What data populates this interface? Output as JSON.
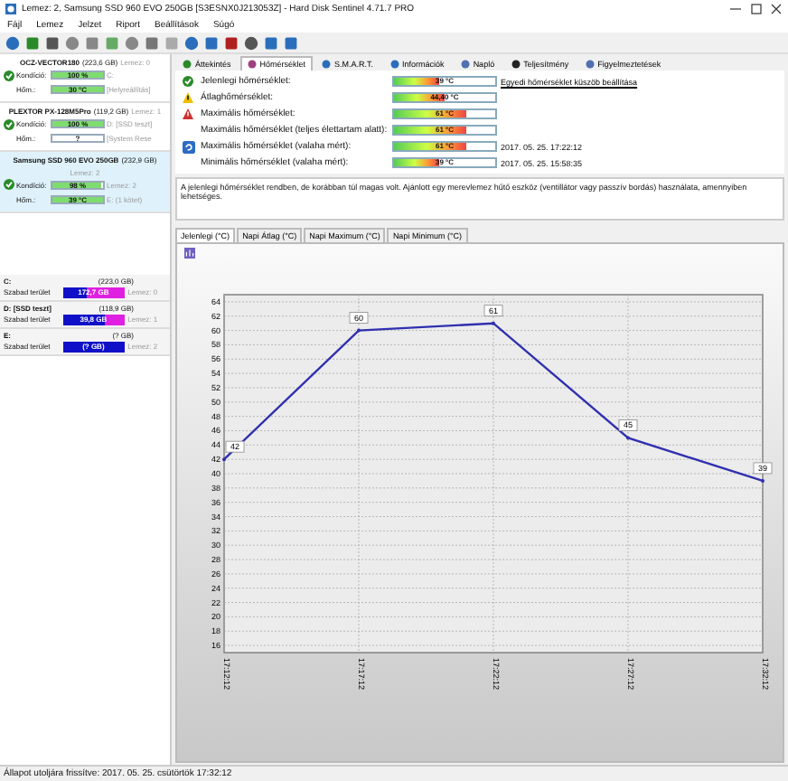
{
  "window": {
    "title": "Lemez: 2, Samsung SSD 960 EVO 250GB [S3ESNX0J213053Z]  -  Hard Disk Sentinel 4.71.7 PRO"
  },
  "menu": [
    "Fájl",
    "Lemez",
    "Jelzet",
    "Riport",
    "Beállítások",
    "Súgó"
  ],
  "disks": [
    {
      "name": "OCZ-VECTOR180",
      "size": "(223,6 GB)",
      "disk_no": "Lemez: 0",
      "selected": false,
      "condition_label": "Kondíció:",
      "condition": {
        "text": "100 %",
        "level": 1
      },
      "condition_extra": "C:",
      "temp_label": "Hőm.:",
      "temp": {
        "text": "30 °C",
        "level": 1
      },
      "temp_extra": "[Helyreállítás]"
    },
    {
      "name": "PLEXTOR PX-128M5Pro",
      "size": "(119,2 GB)",
      "disk_no": "Lemez: 1",
      "selected": false,
      "condition_label": "Kondíció:",
      "condition": {
        "text": "100 %",
        "level": 1
      },
      "condition_extra": "D: [SSD teszt]",
      "temp_label": "Hőm.:",
      "temp": {
        "text": "?",
        "level": 0
      },
      "temp_extra": "[System Rese"
    },
    {
      "name": "Samsung SSD 960 EVO 250GB",
      "size": "(232,9 GB)",
      "disk_no": "Lemez: 2",
      "selected": true,
      "condition_label": "Kondíció:",
      "condition": {
        "text": "98 %",
        "level": 0.98
      },
      "condition_extra": "Lemez: 2",
      "temp_label": "Hőm.:",
      "temp": {
        "text": "39 °C",
        "level": 1
      },
      "temp_extra": "E: (1 kötet)"
    }
  ],
  "partitions": [
    {
      "name": "C:",
      "size": "(223,0 GB)",
      "label": "Szabad terület",
      "free": "172,7 GB",
      "level": 0.6,
      "disk_no": "Lemez: 0"
    },
    {
      "name": "D: [SSD teszt]",
      "size": "(118,9 GB)",
      "label": "Szabad terület",
      "free": "39,8 GB",
      "level": 0.3,
      "disk_no": "Lemez: 1"
    },
    {
      "name": "E:",
      "size": "(? GB)",
      "label": "Szabad terület",
      "free": "(? GB)",
      "level": 0,
      "disk_no": "Lemez: 2"
    }
  ],
  "tabs": [
    {
      "label": "Áttekintés",
      "selected": false
    },
    {
      "label": "Hőmérséklet",
      "selected": true
    },
    {
      "label": "S.M.A.R.T.",
      "selected": false
    },
    {
      "label": "Információk",
      "selected": false
    },
    {
      "label": "Napló",
      "selected": false
    },
    {
      "label": "Teljesítmény",
      "selected": false
    },
    {
      "label": "Figyelmeztetések",
      "selected": false
    }
  ],
  "temperatures": [
    {
      "kind": "ok",
      "label": "Jelenlegi hőmérséklet:",
      "value": "39 °C",
      "level": 0.45,
      "note": "Egyedi hőmérséklet küszöb beállítása"
    },
    {
      "kind": "warning",
      "label": "Átlaghőmérséklet:",
      "value": "44,40 °C",
      "level": 0.5
    },
    {
      "kind": "alert",
      "label": "Maximális hőmérséklet:",
      "value": "61 °C",
      "level": 0.72
    },
    {
      "kind": "none",
      "label": "Maximális hőmérséklet (teljes élettartam alatt):",
      "value": "61 °C",
      "level": 0.72
    },
    {
      "kind": "reset",
      "label": "Maximális hőmérséklet (valaha mért):",
      "value": "61 °C",
      "level": 0.72,
      "date": "2017. 05. 25. 17:22:12"
    },
    {
      "kind": "none",
      "label": "Minimális hőmérséklet (valaha mért):",
      "value": "39 °C",
      "level": 0.45,
      "date": "2017. 05. 25. 15:58:35"
    }
  ],
  "message": "A jelenlegi hőmérséklet rendben, de korábban túl magas volt. Ajánlott egy merevlemez hűtő eszköz (ventillátor vagy passzív bordás) használata, amennyiben lehetséges.",
  "chart_tabs": [
    {
      "label": "Jelenlegi (°C)",
      "selected": true
    },
    {
      "label": "Napi Átlag (°C)",
      "selected": false
    },
    {
      "label": "Napi Maximum (°C)",
      "selected": false
    },
    {
      "label": "Napi Minimum (°C)",
      "selected": false
    }
  ],
  "chart_data": {
    "type": "line",
    "categories": [
      "17:12:12",
      "17:17:12",
      "17:22:12",
      "17:27:12",
      "17:32:12"
    ],
    "series": [
      {
        "color": "#3030b0",
        "values": [
          42,
          60,
          61,
          45,
          39
        ]
      }
    ],
    "ylim": [
      15,
      65
    ],
    "yticks": [
      16,
      18,
      20,
      22,
      24,
      26,
      28,
      30,
      32,
      34,
      36,
      38,
      40,
      42,
      44,
      46,
      48,
      50,
      52,
      54,
      56,
      58,
      60,
      62,
      64
    ],
    "grid": true,
    "data_labels": true
  },
  "status_bar": "Állapot utoljára frissítve: 2017. 05. 25. csütörtök 17:32:12"
}
